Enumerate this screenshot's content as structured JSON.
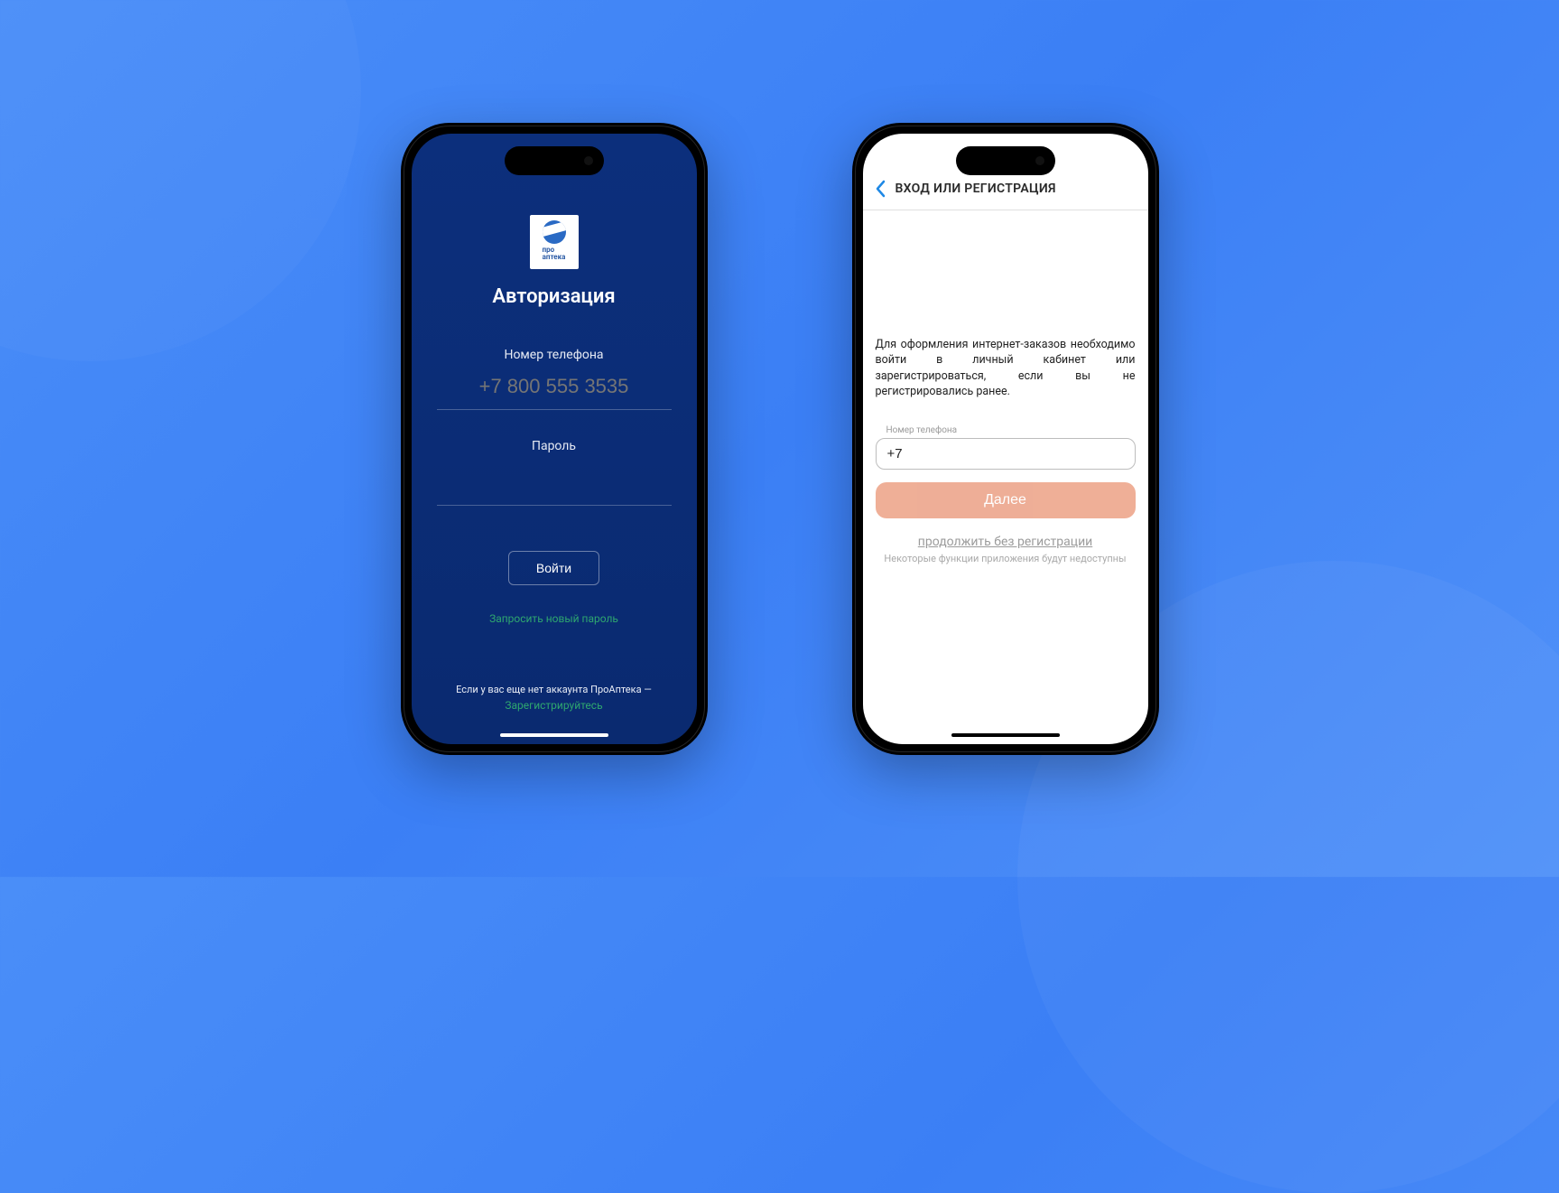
{
  "phone1": {
    "logo_line1": "про",
    "logo_line2": "аптека",
    "title": "Авторизация",
    "phone_label": "Номер телефона",
    "phone_placeholder": "+7 800 555 3535",
    "password_label": "Пароль",
    "login_button": "Войти",
    "reset_link": "Запросить новый пароль",
    "footer_text": "Если у вас еще нет аккаунта ПроАптека —",
    "register_link": "Зарегистрируйтесь"
  },
  "phone2": {
    "nav_title": "ВХОД ИЛИ РЕГИСТРАЦИЯ",
    "description_lines": "Для оформления интернет-заказов необходимо войти в личный кабинет или зарегистрироваться, если вы не",
    "description_last": "регистрировались ранее.",
    "phone_label": "Номер телефона",
    "phone_value": "+7",
    "next_button": "Далее",
    "skip_link": "продолжить без регистрации",
    "skip_note": "Некоторые функции приложения будут недоступны"
  }
}
